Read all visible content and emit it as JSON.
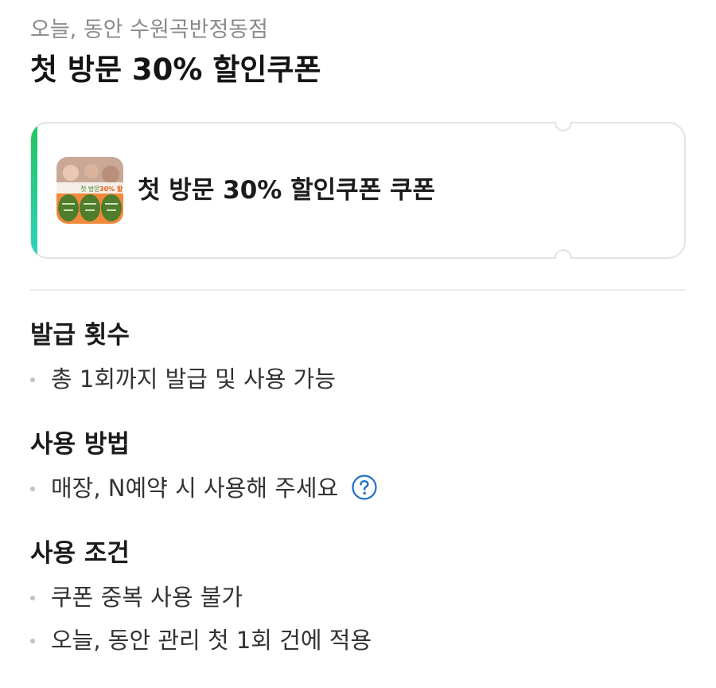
{
  "header": {
    "store_line": "오늘, 동안 수원곡반정동점",
    "title": "첫 방문 30% 할인쿠폰"
  },
  "coupon_card": {
    "label": "첫 방문 30% 할인쿠폰 쿠폰",
    "accent_gradient": [
      "#22c55e",
      "#2dd4bf"
    ],
    "thumbnail": {
      "icon": "coupon-thumbnail-image",
      "text": "첫 방문 30% 할인"
    }
  },
  "sections": [
    {
      "heading": "발급 횟수",
      "items": [
        "총 1회까지 발급 및 사용 가능"
      ]
    },
    {
      "heading": "사용 방법",
      "items": [
        "매장, N예약 시 사용해 주세요"
      ],
      "help_icon": "question-circle-icon"
    },
    {
      "heading": "사용 조건",
      "items": [
        "쿠폰 중복 사용 불가",
        "오늘, 동안 관리 첫 1회 건에 적용"
      ]
    }
  ],
  "colors": {
    "help_icon": "#1e6fc9",
    "bullet": "#c2c2c2",
    "store_line": "#8a8a8a"
  }
}
